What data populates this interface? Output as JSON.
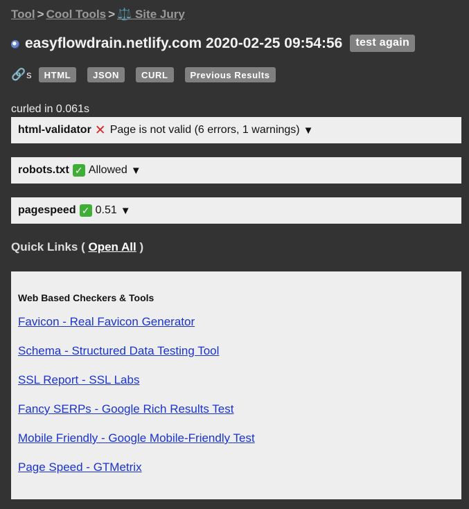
{
  "breadcrumb": {
    "items": [
      "Tool",
      "Cool Tools",
      "Site Jury"
    ],
    "separator": ">",
    "jury_icon": "scale-icon"
  },
  "header": {
    "icon": "globe-icon",
    "title": "easyflowdrain.netlify.com 2020-02-25 09:54:56",
    "test_again_label": "test again"
  },
  "links": {
    "icon": "link-icon",
    "suffix": "s",
    "buttons": [
      "HTML",
      "JSON",
      "CURL",
      "Previous Results"
    ]
  },
  "curled": "curled in 0.061s",
  "results": [
    {
      "name": "html-validator",
      "status_icon": "cross-icon",
      "text": "Page is not valid (6 errors, 1 warnings)",
      "toggle": "▼"
    },
    {
      "name": "robots.txt",
      "status_icon": "check-icon",
      "text": "Allowed",
      "toggle": "▼"
    },
    {
      "name": "pagespeed",
      "status_icon": "check-icon",
      "text": "0.51",
      "toggle": "▼"
    }
  ],
  "quick_links": {
    "label": "Quick Links (",
    "open_all": "Open All",
    "close": ")"
  },
  "tools": {
    "heading": "Web Based Checkers & Tools",
    "links": [
      "Favicon - Real Favicon Generator",
      "Schema - Structured Data Testing Tool",
      "SSL Report - SSL Labs",
      "Fancy SERPs - Google Rich Results Test",
      "Mobile Friendly - Google Mobile-Friendly Test",
      "Page Speed - GTMetrix"
    ]
  },
  "colors": {
    "background": "#333333",
    "button": "#808080",
    "panel": "#eeeeee",
    "link": "#1a33cc",
    "error": "#d9262c",
    "ok": "#3fae36"
  }
}
